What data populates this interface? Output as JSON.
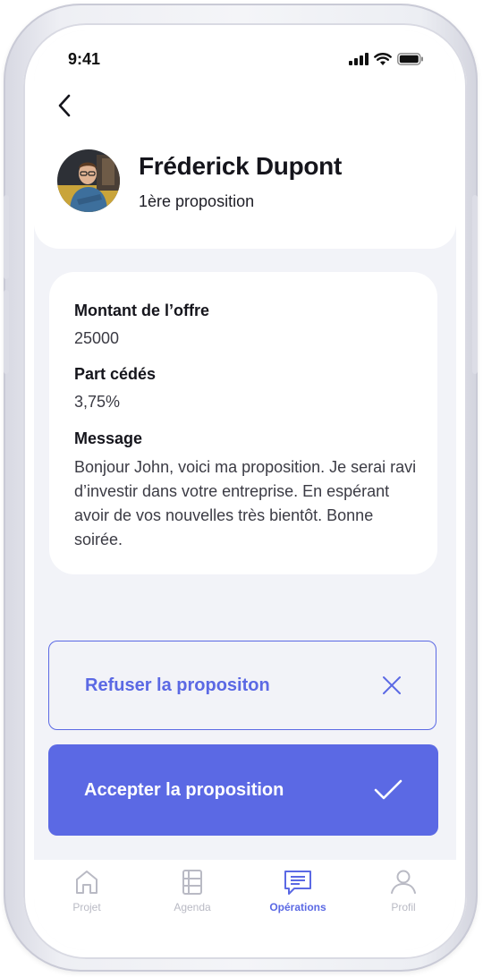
{
  "status_bar": {
    "time": "9:41"
  },
  "profile": {
    "name": "Fréderick Dupont",
    "subtitle": "1ère proposition"
  },
  "offer": {
    "amount_label": "Montant de l’offre",
    "amount_value": "25000",
    "share_label": "Part cédés",
    "share_value": "3,75%",
    "message_label": "Message",
    "message_value": "Bonjour John, voici ma proposition. Je serai ravi d’investir dans votre entreprise. En espérant avoir de vos nouvelles très bientôt. Bonne soirée."
  },
  "actions": {
    "refuse_label": "Refuser la propositon",
    "accept_label": "Accepter la proposition"
  },
  "nav": {
    "items": [
      {
        "label": "Projet",
        "icon": "home-icon"
      },
      {
        "label": "Agenda",
        "icon": "agenda-icon"
      },
      {
        "label": "Opérations",
        "icon": "operations-icon"
      },
      {
        "label": "Profil",
        "icon": "profile-icon"
      }
    ],
    "active": "Opérations"
  },
  "colors": {
    "accent": "#5b69e4",
    "background": "#f2f3f8",
    "text": "#15151c",
    "inactive": "#b9bac4"
  }
}
